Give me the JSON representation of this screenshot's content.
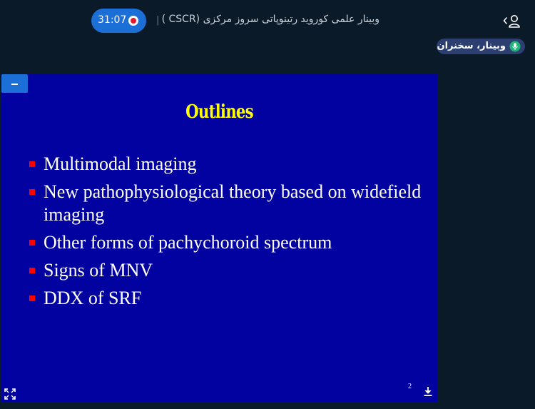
{
  "header": {
    "title": "وبینار علمی کوروید رتینوپاتی سروز مرکزی (CSCR )",
    "divider": "|",
    "recording": {
      "time": "31:07",
      "color": "#1b6fd6"
    },
    "user_icon": "user-icon"
  },
  "badge": {
    "label": "وبینار، سخنران",
    "icon": "microphone-icon",
    "color": "#2c3f70"
  },
  "slide": {
    "background": "#0202a0",
    "title": "Outlines",
    "title_color": "#ffff00",
    "bullet_color": "#ff0000",
    "bullets": [
      "Multimodal imaging",
      "New pathophysiological theory based on widefield imaging",
      "Other forms of pachychoroid spectrum",
      "Signs of MNV",
      "DDX of SRF"
    ],
    "page_number": "2"
  },
  "controls": {
    "minimize_icon": "minus-icon",
    "download_icon": "download-icon",
    "fullscreen_icon": "fullscreen-icon"
  }
}
